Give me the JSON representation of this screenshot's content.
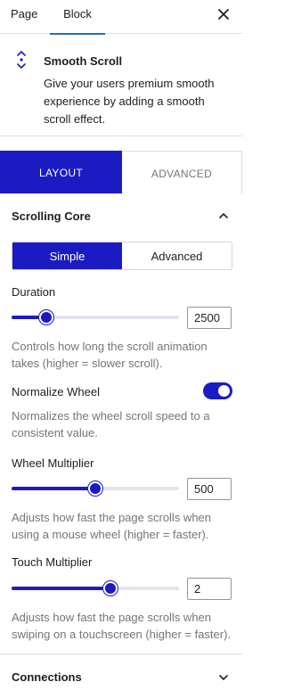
{
  "top_tabs": {
    "page": "Page",
    "block": "Block"
  },
  "block": {
    "title": "Smooth Scroll",
    "description": "Give your users premium smooth experience by adding a smooth scroll effect."
  },
  "main_tabs": {
    "layout": "LAYOUT",
    "advanced": "ADVANCED",
    "active": "layout"
  },
  "scrolling_core": {
    "title": "Scrolling Core",
    "expanded": true,
    "mode": {
      "simple": "Simple",
      "advanced": "Advanced",
      "active": "simple"
    },
    "duration": {
      "label": "Duration",
      "value": "2500",
      "slider_fraction": 0.21,
      "help": "Controls how long the scroll animation takes (higher = slower scroll)."
    },
    "normalize_wheel": {
      "label": "Normalize Wheel",
      "enabled": true,
      "help": "Normalizes the wheel scroll speed to a consistent value."
    },
    "wheel_multiplier": {
      "label": "Wheel Multiplier",
      "value": "500",
      "slider_fraction": 0.5,
      "help": "Adjusts how fast the page scrolls when using a mouse wheel (higher = faster)."
    },
    "touch_multiplier": {
      "label": "Touch Multiplier",
      "value": "2",
      "slider_fraction": 0.59,
      "help": "Adjusts how fast the page scrolls when swiping on a touchscreen (higher = faster)."
    }
  },
  "connections": {
    "title": "Connections",
    "expanded": false
  },
  "colors": {
    "accent": "#1b1bc4",
    "tab_underline": "#2271b1",
    "help_text": "#757575"
  },
  "icons": {
    "close": "close-icon",
    "block": "scroll-arrows-icon",
    "collapse": "chevron-up-icon",
    "expand": "chevron-down-icon"
  }
}
